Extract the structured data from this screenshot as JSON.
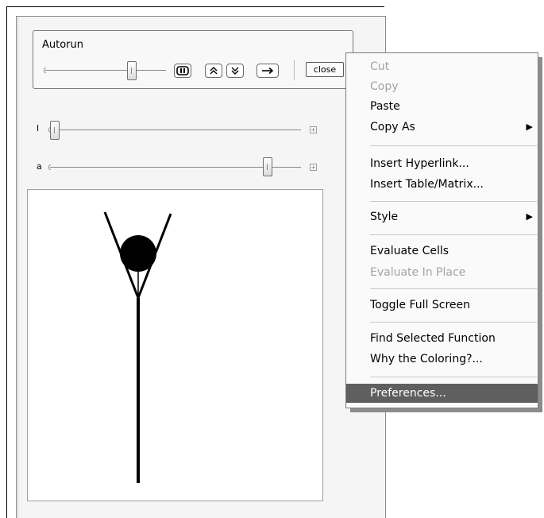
{
  "panel": {
    "autorun_title": "Autorun",
    "close_label": "close",
    "controls": [
      {
        "label": "l",
        "slider_fraction": 0.0
      },
      {
        "label": "a",
        "slider_fraction": 0.86
      }
    ],
    "autorun_slider_fraction": 0.72,
    "buttons": [
      "pause-icon",
      "faster-icon",
      "slower-icon",
      "step-forward-icon"
    ],
    "plus_glyph": "+"
  },
  "context_menu": {
    "items": [
      {
        "label": "Cut",
        "enabled": false
      },
      {
        "label": "Copy",
        "enabled": false
      },
      {
        "label": "Paste",
        "enabled": true
      },
      {
        "label": "Copy As",
        "enabled": true,
        "submenu": true
      },
      {
        "label": "Insert Hyperlink...",
        "enabled": true
      },
      {
        "label": "Insert Table/Matrix...",
        "enabled": true
      },
      {
        "label": "Style",
        "enabled": true,
        "submenu": true
      },
      {
        "label": "Evaluate Cells",
        "enabled": true
      },
      {
        "label": "Evaluate In Place",
        "enabled": false
      },
      {
        "label": "Toggle Full Screen",
        "enabled": true
      },
      {
        "label": "Find Selected Function",
        "enabled": true
      },
      {
        "label": "Why the Coloring?...",
        "enabled": true
      },
      {
        "label": "Preferences...",
        "enabled": true,
        "highlighted": true
      }
    ],
    "submenu_arrow": "▶"
  },
  "colors": {
    "menu_highlight": "#5f5f5f",
    "disabled_text": "#a3a3a3"
  }
}
